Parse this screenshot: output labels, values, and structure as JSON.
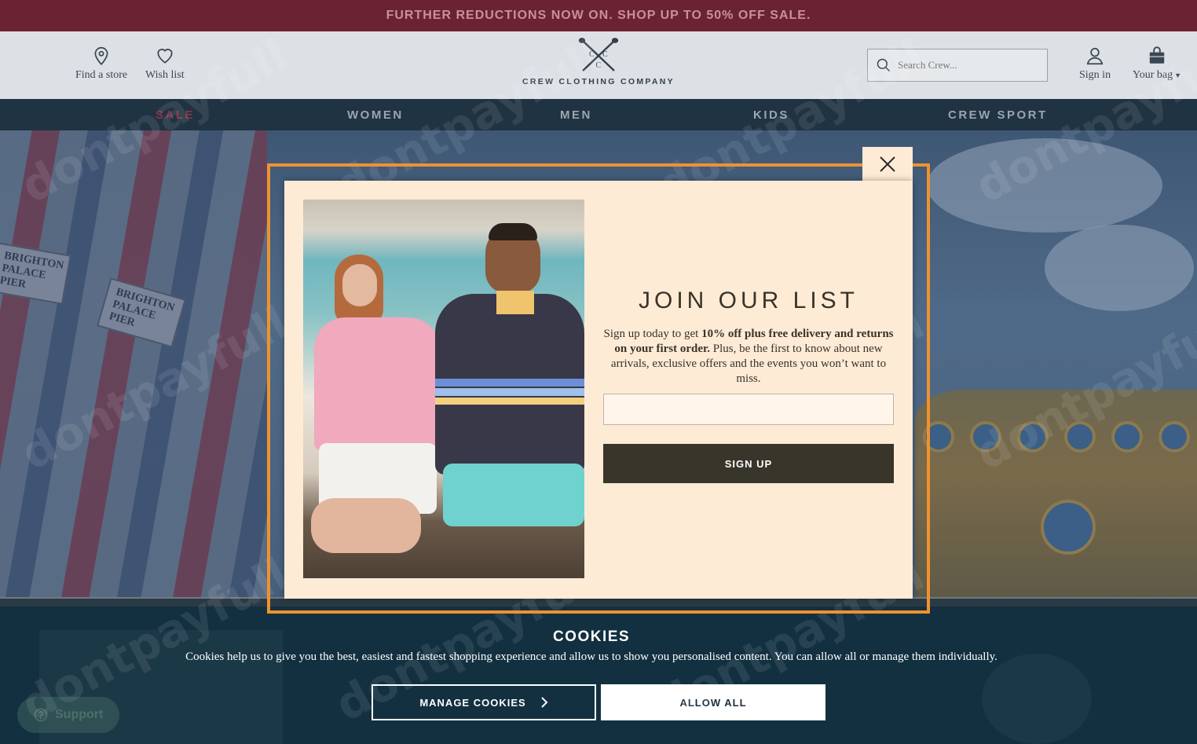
{
  "promo": {
    "text": "FURTHER REDUCTIONS NOW ON. SHOP UP TO 50% OFF SALE."
  },
  "header": {
    "find_store": "Find a store",
    "wish_list": "Wish list",
    "logo_text": "CREW CLOTHING COMPANY",
    "search_placeholder": "Search Crew...",
    "sign_in": "Sign in",
    "bag": "Your bag"
  },
  "nav": {
    "items": [
      {
        "label": "SALE",
        "color": "#c0475e"
      },
      {
        "label": "WOMEN",
        "color": "#9aa6b0"
      },
      {
        "label": "MEN",
        "color": "#9aa6b0"
      },
      {
        "label": "KIDS",
        "color": "#9aa6b0"
      },
      {
        "label": "CREW SPORT",
        "color": "#9aa6b0"
      }
    ]
  },
  "hero": {
    "sign_1": "BRIGHTON PALACE PIER",
    "sign_2": "BRIGHTON PALACE PIER"
  },
  "modal": {
    "title": "JOIN OUR LIST",
    "text_prefix": "Sign up today to get ",
    "text_bold": "10% off plus free delivery and returns on your first order.",
    "text_suffix": " Plus, be the first to know about new arrivals, exclusive offers and the events you won’t want to miss.",
    "email_placeholder": "",
    "signup_label": "SIGN UP",
    "accent": "#f0922e"
  },
  "cookies": {
    "title": "COOKIES",
    "text": "Cookies help us to give you the best, easiest and fastest shopping experience and allow us to show you personalised content. You can allow all or manage them individually.",
    "manage_label": "MANAGE COOKIES",
    "allow_label": "ALLOW ALL"
  },
  "support": {
    "label": "Support"
  },
  "watermark": {
    "text": "dontpayfull"
  }
}
